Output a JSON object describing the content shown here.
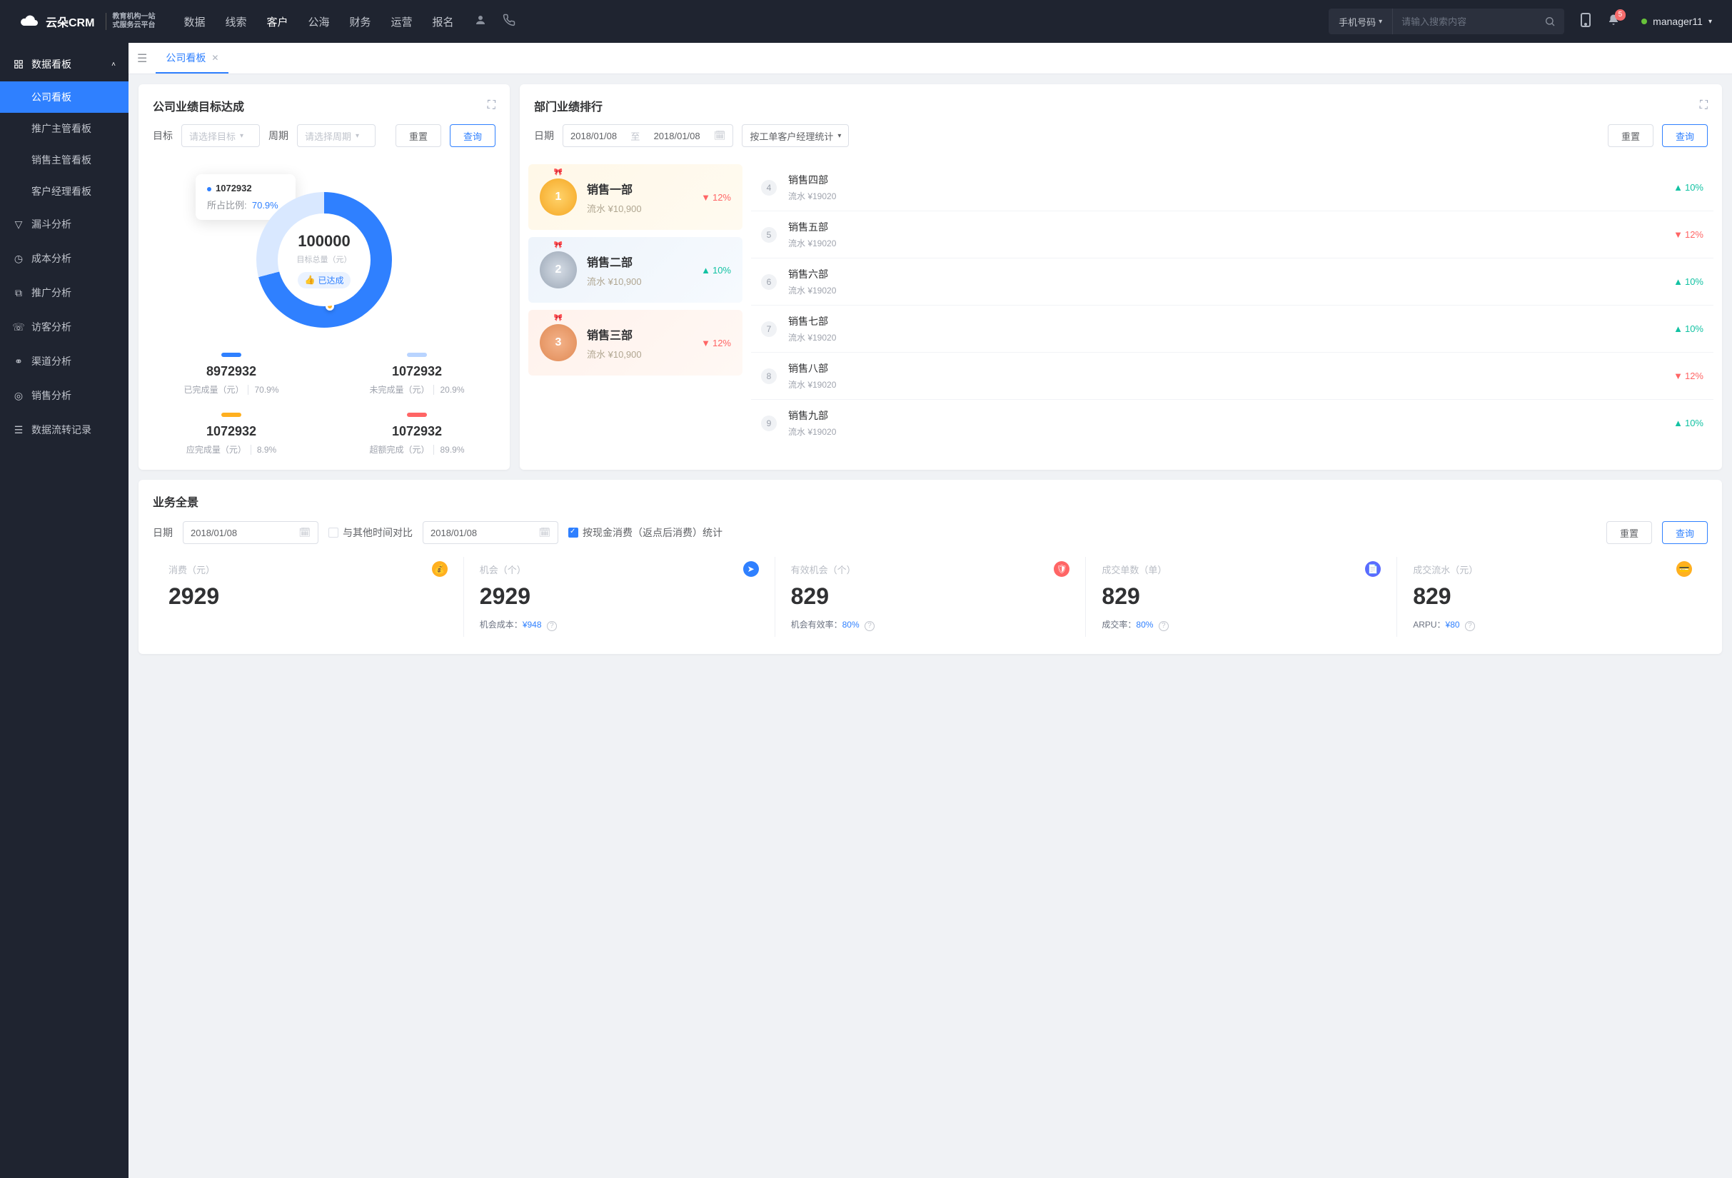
{
  "header": {
    "logo_brand": "云朵CRM",
    "logo_sub1": "教育机构一站",
    "logo_sub2": "式服务云平台",
    "menu": [
      "数据",
      "线索",
      "客户",
      "公海",
      "财务",
      "运营",
      "报名"
    ],
    "active_menu": "客户",
    "search_type_label": "手机号码",
    "search_placeholder": "请输入搜索内容",
    "notif_count": "5",
    "user": "manager11"
  },
  "sidebar": {
    "group": "数据看板",
    "items": [
      "公司看板",
      "推广主管看板",
      "销售主管看板",
      "客户经理看板"
    ],
    "roots": [
      "漏斗分析",
      "成本分析",
      "推广分析",
      "访客分析",
      "渠道分析",
      "销售分析",
      "数据流转记录"
    ]
  },
  "tabs": {
    "name": "公司看板"
  },
  "cards": {
    "goals": {
      "title": "公司业绩目标达成",
      "filter_target_label": "目标",
      "filter_target_ph": "请选择目标",
      "filter_period_label": "周期",
      "filter_period_ph": "请选择周期",
      "reset": "重置",
      "query": "查询",
      "total_value": "100000",
      "total_label": "目标总量（元）",
      "status_tag": "已达成",
      "tooltip_value": "1072932",
      "tooltip_label": "所占比例:",
      "tooltip_pct": "70.9%",
      "legend": [
        {
          "value": "8972932",
          "label": "已完成量（元）",
          "pct": "70.9%"
        },
        {
          "value": "1072932",
          "label": "未完成量（元）",
          "pct": "20.9%"
        },
        {
          "value": "1072932",
          "label": "应完成量（元）",
          "pct": "8.9%"
        },
        {
          "value": "1072932",
          "label": "超额完成（元）",
          "pct": "89.9%"
        }
      ]
    },
    "rank": {
      "title": "部门业绩排行",
      "date_label": "日期",
      "date_start": "2018/01/08",
      "date_mid": "至",
      "date_end": "2018/01/08",
      "stat_by": "按工单客户经理统计",
      "reset": "重置",
      "query": "查询",
      "top": [
        {
          "name": "销售一部",
          "amount": "流水 ¥10,900",
          "rate": "12%",
          "dir": "down"
        },
        {
          "name": "销售二部",
          "amount": "流水 ¥10,900",
          "rate": "10%",
          "dir": "up"
        },
        {
          "name": "销售三部",
          "amount": "流水 ¥10,900",
          "rate": "12%",
          "dir": "down"
        }
      ],
      "list": [
        {
          "rank": "4",
          "name": "销售四部",
          "amount": "流水 ¥19020",
          "rate": "10%",
          "dir": "up"
        },
        {
          "rank": "5",
          "name": "销售五部",
          "amount": "流水 ¥19020",
          "rate": "12%",
          "dir": "down"
        },
        {
          "rank": "6",
          "name": "销售六部",
          "amount": "流水 ¥19020",
          "rate": "10%",
          "dir": "up"
        },
        {
          "rank": "7",
          "name": "销售七部",
          "amount": "流水 ¥19020",
          "rate": "10%",
          "dir": "up"
        },
        {
          "rank": "8",
          "name": "销售八部",
          "amount": "流水 ¥19020",
          "rate": "12%",
          "dir": "down"
        },
        {
          "rank": "9",
          "name": "销售九部",
          "amount": "流水 ¥19020",
          "rate": "10%",
          "dir": "up"
        }
      ]
    },
    "biz": {
      "title": "业务全景",
      "date_label": "日期",
      "date_start": "2018/01/08",
      "compare_label": "与其他时间对比",
      "date_end": "2018/01/08",
      "checkbox_label": "按现金消费（返点后消费）统计",
      "reset": "重置",
      "query": "查询",
      "stats": [
        {
          "title": "消费（元）",
          "value": "2929",
          "sub": "",
          "sub_val": ""
        },
        {
          "title": "机会（个）",
          "value": "2929",
          "sub": "机会成本：",
          "sub_val": "¥948"
        },
        {
          "title": "有效机会（个）",
          "value": "829",
          "sub": "机会有效率：",
          "sub_val": "80%"
        },
        {
          "title": "成交单数（单）",
          "value": "829",
          "sub": "成交率：",
          "sub_val": "80%"
        },
        {
          "title": "成交流水（元）",
          "value": "829",
          "sub": "ARPU：",
          "sub_val": "¥80"
        }
      ]
    }
  },
  "chart_data": {
    "type": "pie",
    "title": "公司业绩目标达成",
    "total": 100000,
    "total_label": "目标总量（元）",
    "series": [
      {
        "name": "已完成量",
        "value": 8972932,
        "pct": 70.9,
        "color": "#2f80ff"
      },
      {
        "name": "未完成量",
        "value": 1072932,
        "pct": 20.9,
        "color": "#b9d4ff"
      },
      {
        "name": "应完成量",
        "value": 1072932,
        "pct": 8.9,
        "color": "#ffb020"
      },
      {
        "name": "超额完成",
        "value": 1072932,
        "pct": 89.9,
        "color": "#ff6565"
      }
    ]
  }
}
